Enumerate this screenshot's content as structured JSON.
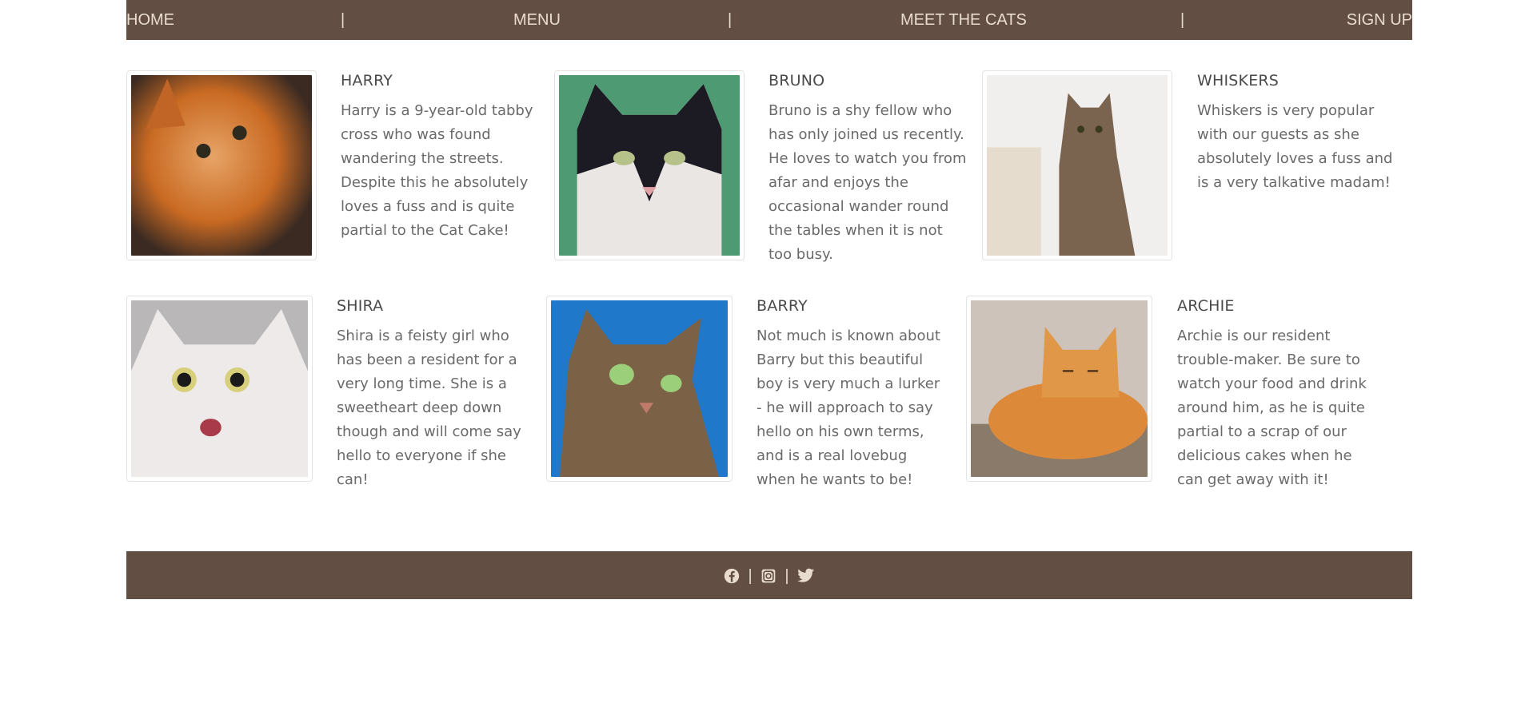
{
  "nav": {
    "home": "HOME",
    "menu": "MENU",
    "meet": "MEET THE CATS",
    "signup": "SIGN UP",
    "separator": "|"
  },
  "cats": [
    {
      "name": "HARRY",
      "description": "Harry is a 9-year-old tabby cross who was found wandering the streets. Despite this he absolutely loves a fuss and is quite partial to the Cat Cake!"
    },
    {
      "name": "BRUNO",
      "description": "Bruno is a shy fellow who has only joined us recently. He loves to watch you from afar and enjoys the occasional wander round the tables when it is not too busy."
    },
    {
      "name": "WHISKERS",
      "description": "Whiskers is very popular with our guests as she absolutely loves a fuss and is a very talkative madam!"
    },
    {
      "name": "SHIRA",
      "description": "Shira is a feisty girl who has been a resident for a very long time. She is a sweetheart deep down though and will come say hello to everyone if she can!"
    },
    {
      "name": "BARRY",
      "description": "Not much is known about Barry but this beautiful boy is very much a lurker - he will approach to say hello on his own terms, and is a real lovebug when he wants to be!"
    },
    {
      "name": "ARCHIE",
      "description": "Archie is our resident trouble-maker. Be sure to watch your food and drink around him, as he is quite partial to a scrap of our delicious cakes when he can get away with it!"
    }
  ],
  "footer": {
    "icons": [
      "facebook-icon",
      "instagram-icon",
      "twitter-icon"
    ],
    "separator": "|"
  },
  "colors": {
    "brand_brown": "#624e42",
    "nav_text": "#e9dccf"
  }
}
